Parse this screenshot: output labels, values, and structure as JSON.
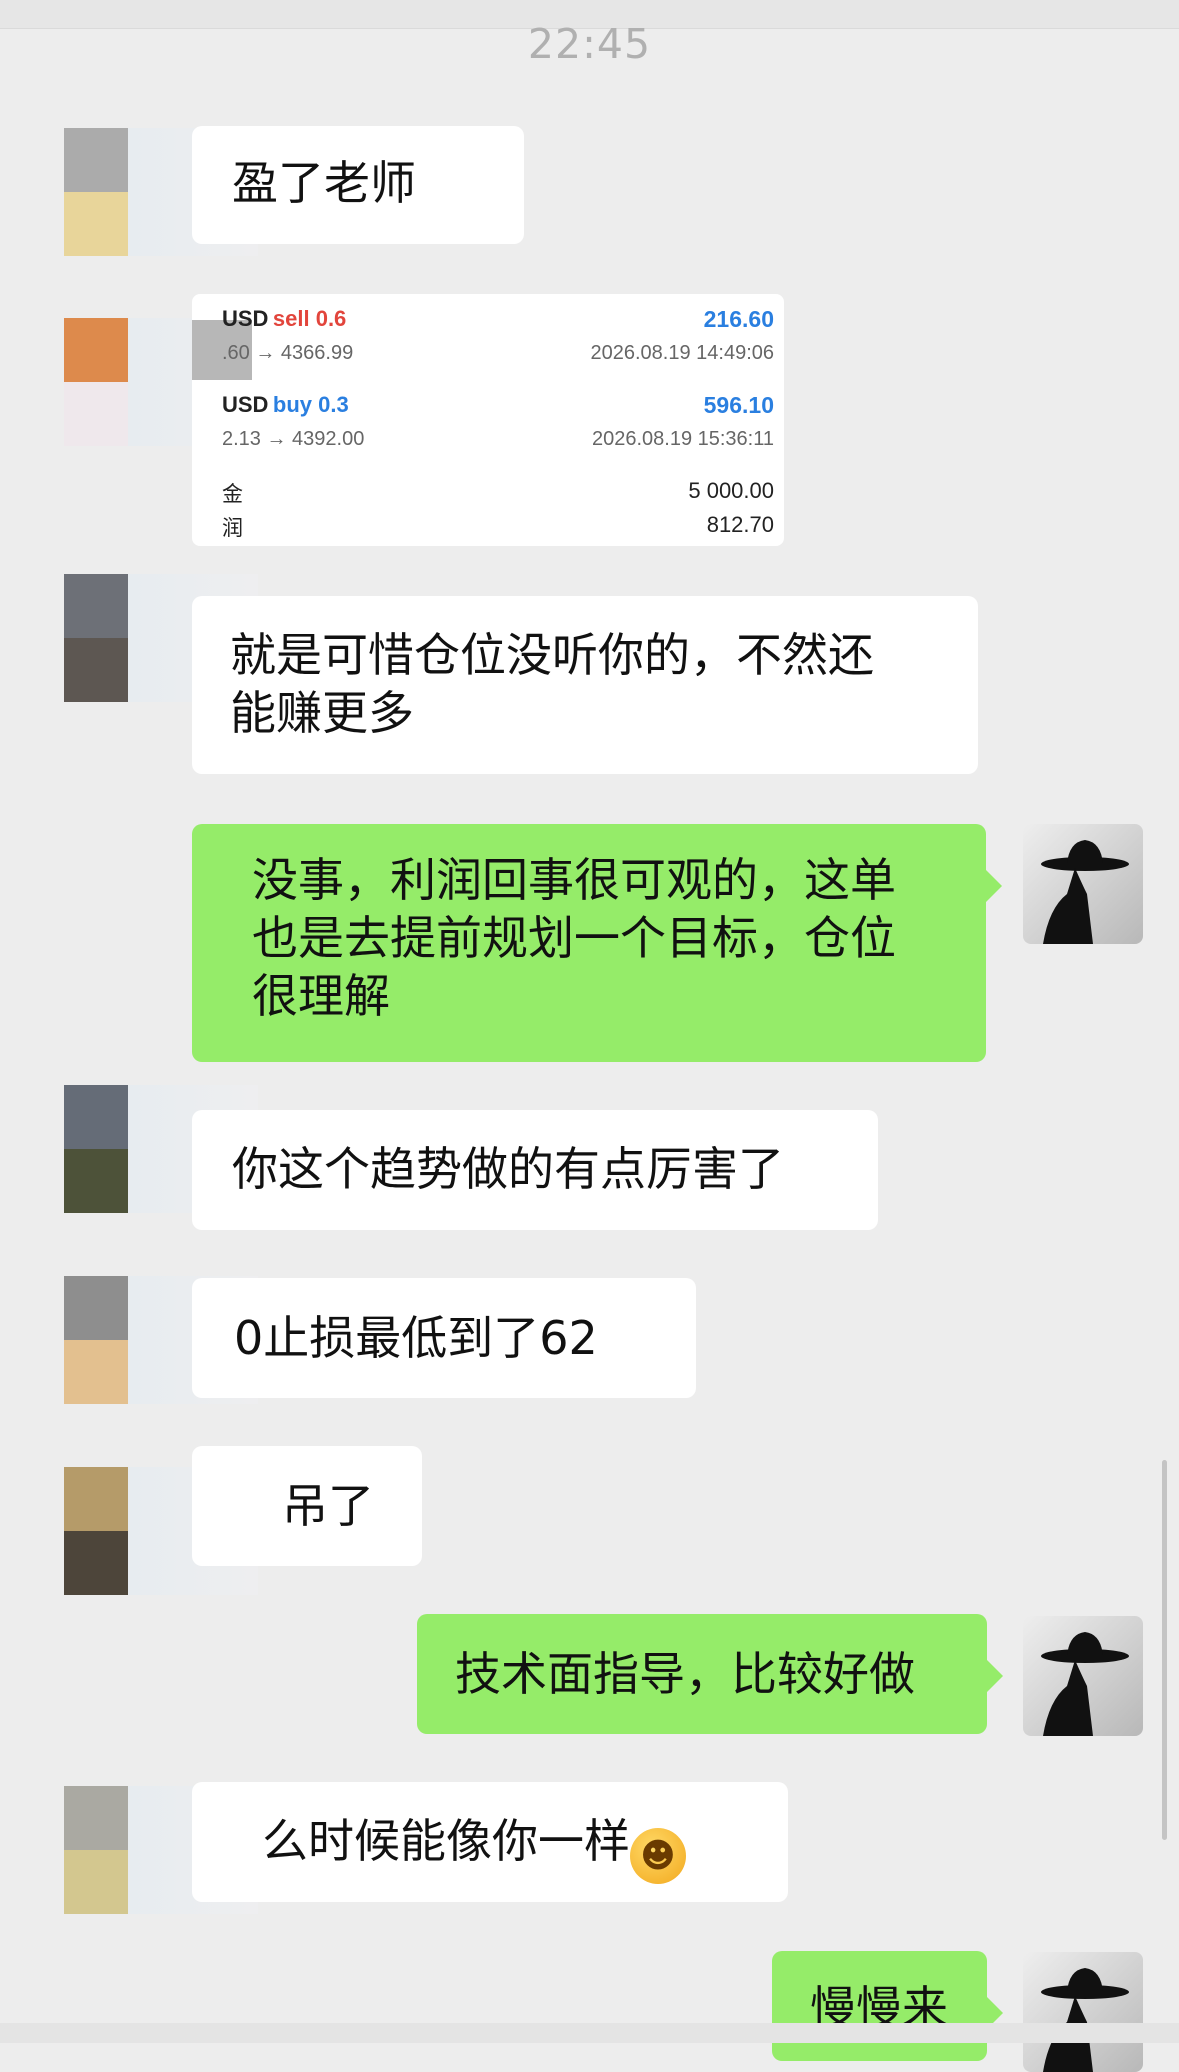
{
  "chat": {
    "timestamp": "22:45",
    "messages": [
      {
        "side": "in",
        "text": "盈了老师"
      },
      {
        "side": "in",
        "type": "trade_card"
      },
      {
        "side": "in",
        "text": "就是可惜仓位没听你的，不然还\n能赚更多"
      },
      {
        "side": "out",
        "text": "没事，利润回事很可观的，这单\n也是去提前规划一个目标，仓位\n很理解"
      },
      {
        "side": "in",
        "text": "你这个趋势做的有点厉害了"
      },
      {
        "side": "in",
        "text": "0止损最低到了62"
      },
      {
        "side": "in",
        "text": "吊了"
      },
      {
        "side": "out",
        "text": "技术面指导，比较好做"
      },
      {
        "side": "in",
        "text": "么时候能像你一样"
      },
      {
        "side": "out",
        "text": "慢慢来"
      }
    ]
  },
  "trade_card": {
    "trade1": {
      "symbol": "USD",
      "side": "sell 0.6",
      "profit": "216.60",
      "prices": ".60 → 4366.99",
      "date": "2026.08.19 14:49:06"
    },
    "trade2": {
      "symbol": "USD",
      "side": "buy 0.3",
      "profit": "596.10",
      "prices": "2.13 → 4392.00",
      "date": "2026.08.19 15:36:11"
    },
    "summary": {
      "label1": "金",
      "value1": "5 000.00",
      "label2": "润",
      "value2": "812.70"
    }
  },
  "colors": {
    "incoming_bubble": "#ffffff",
    "outgoing_bubble": "#95ec69",
    "sell": "#e2453c",
    "buy_profit": "#2a7fe0"
  },
  "icons": {
    "emoji": "face-with-tears-emoji"
  }
}
